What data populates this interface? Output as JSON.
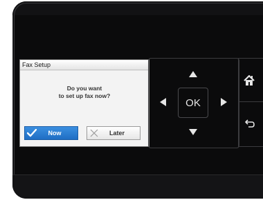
{
  "dialog": {
    "title": "Fax Setup",
    "message_line1": "Do you want",
    "message_line2": "to set up fax now?",
    "now_label": "Now",
    "later_label": "Later"
  },
  "controls": {
    "ok_label": "OK"
  },
  "icons": {
    "now": "checkmark-icon",
    "later": "x-icon",
    "up": "arrow-up-icon",
    "down": "arrow-down-icon",
    "left": "arrow-left-icon",
    "right": "arrow-right-icon",
    "home": "home-icon",
    "back": "back-icon"
  },
  "colors": {
    "accent": "#1f6ec4",
    "panel": "#0b0b0c"
  }
}
